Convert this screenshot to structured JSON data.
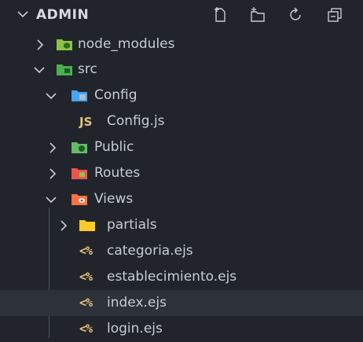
{
  "explorer": {
    "title": "ADMIN",
    "header_icons": [
      "new-file-icon",
      "new-folder-icon",
      "refresh-icon",
      "collapse-all-icon"
    ],
    "items": [
      {
        "label": "node_modules",
        "type": "folder",
        "expanded": false,
        "icon": "node-modules-folder-icon"
      },
      {
        "label": "src",
        "type": "folder",
        "expanded": true,
        "icon": "src-folder-icon"
      },
      {
        "label": "Config",
        "type": "folder",
        "expanded": true,
        "icon": "config-folder-icon"
      },
      {
        "label": "Config.js",
        "type": "file",
        "glyph": "JS",
        "icon": "javascript-file-icon"
      },
      {
        "label": "Public",
        "type": "folder",
        "expanded": false,
        "icon": "public-folder-icon"
      },
      {
        "label": "Routes",
        "type": "folder",
        "expanded": false,
        "icon": "routes-folder-icon"
      },
      {
        "label": "Views",
        "type": "folder",
        "expanded": true,
        "icon": "views-folder-icon"
      },
      {
        "label": "partials",
        "type": "folder",
        "expanded": false,
        "icon": "folder-icon"
      },
      {
        "label": "categoria.ejs",
        "type": "file",
        "glyph": "<%",
        "icon": "ejs-file-icon"
      },
      {
        "label": "establecimiento.ejs",
        "type": "file",
        "glyph": "<%",
        "icon": "ejs-file-icon"
      },
      {
        "label": "index.ejs",
        "type": "file",
        "glyph": "<%",
        "icon": "ejs-file-icon",
        "selected": true
      },
      {
        "label": "login.ejs",
        "type": "file",
        "glyph": "<%",
        "icon": "ejs-file-icon"
      }
    ]
  },
  "colors": {
    "background": "#21252b",
    "selected_row": "#2c313a",
    "text": "#c7ccd4",
    "file_glyph": "#e5c07b",
    "node_modules_folder": "#8bc34a",
    "src_folder": "#4caf50",
    "config_folder": "#42a5f5",
    "public_folder": "#66bb6a",
    "routes_folder": "#ef5350",
    "views_folder": "#ff7043",
    "partials_folder": "#ffca28"
  }
}
